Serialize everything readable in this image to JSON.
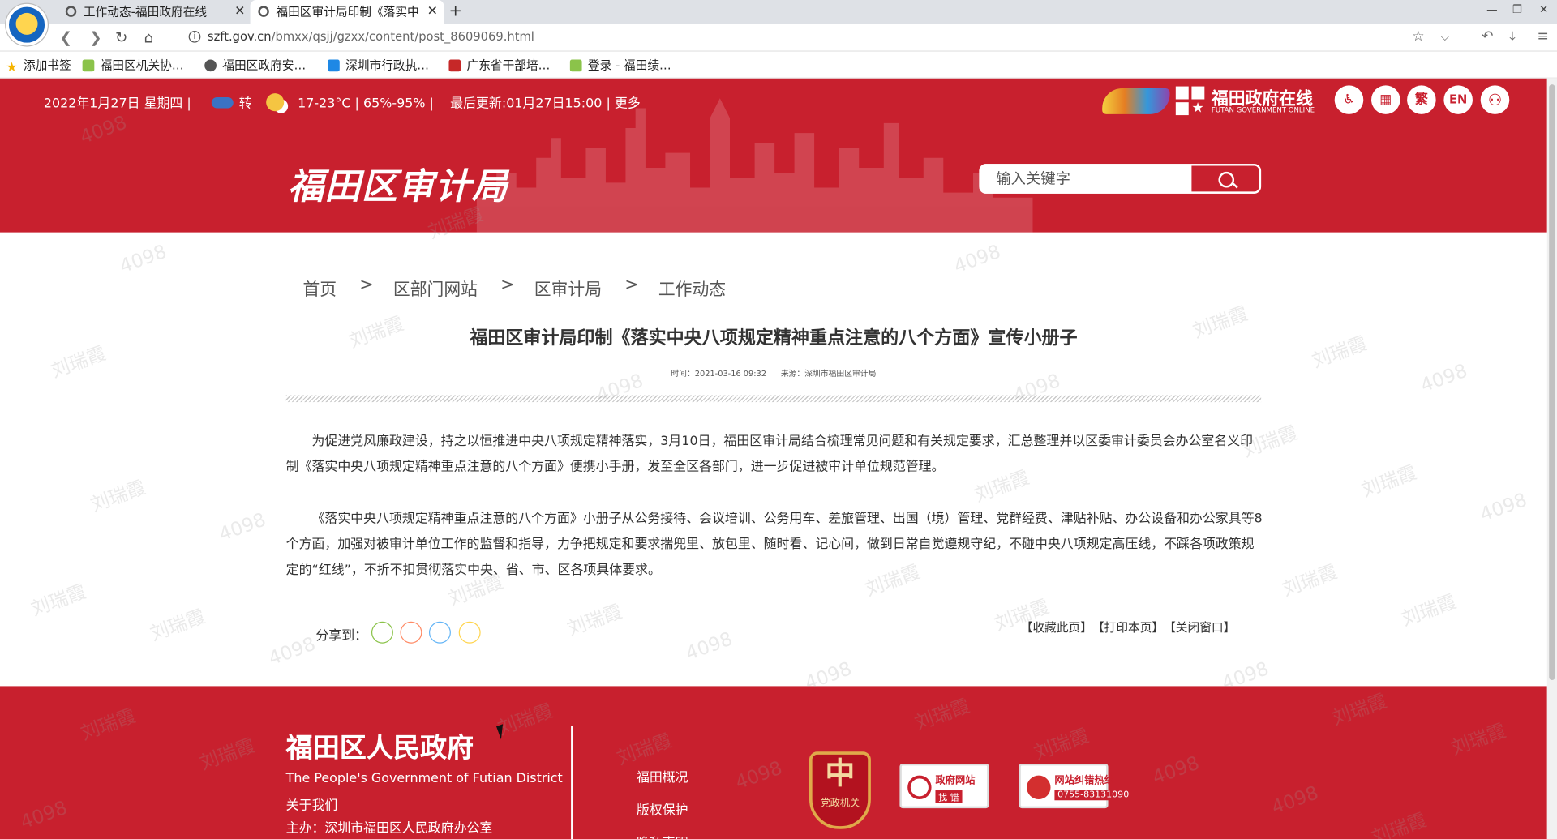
{
  "browser": {
    "tabs": [
      {
        "title": "工作动态-福田政府在线",
        "active": false
      },
      {
        "title": "福田区审计局印制《落实中",
        "active": true
      }
    ],
    "url_host": "szft.gov.cn",
    "url_path": "/bmxx/qsjj/gzxx/content/post_8609069.html",
    "bookmarks": [
      "添加书签",
      "福田区机关协…",
      "福田区政府安…",
      "深圳市行政执…",
      "广东省干部培…",
      "登录 - 福田绩…"
    ]
  },
  "site": {
    "topbar": {
      "date": "2022年1月27日 星期四 |",
      "weather_change": "转",
      "weather": "17-23°C | 65%-95% |",
      "update": "最后更新:01月27日15:00 | 更多"
    },
    "brand_title": "福田政府在线",
    "brand_subtitle": "FUTAN GOVERNMENT ONLINE",
    "header_icons": [
      {
        "name": "accessibility-icon",
        "label": "♿"
      },
      {
        "name": "calendar-icon",
        "label": "▦"
      },
      {
        "name": "traditional-chinese-icon",
        "label": "繁"
      },
      {
        "name": "english-icon",
        "label": "EN"
      },
      {
        "name": "sitemap-icon",
        "label": "⚇"
      }
    ],
    "title": "福田区审计局",
    "search_placeholder": "输入关键字"
  },
  "breadcrumb": [
    "首页",
    "区部门网站",
    "区审计局",
    "工作动态"
  ],
  "breadcrumb_sep": ">",
  "article": {
    "title": "福田区审计局印制《落实中央八项规定精神重点注意的八个方面》宣传小册子",
    "time": "时间：2021-03-16 09:32",
    "source": "来源：深圳市福田区审计局",
    "paragraphs": [
      "为促进党风廉政建设，持之以恒推进中央八项规定精神落实，3月10日，福田区审计局结合梳理常见问题和有关规定要求，汇总整理并以区委审计委员会办公室名义印制《落实中央八项规定精神重点注意的八个方面》便携小手册，发至全区各部门，进一步促进被审计单位规范管理。",
      "《落实中央八项规定精神重点注意的八个方面》小册子从公务接待、会议培训、公务用车、差旅管理、出国（境）管理、党群经费、津贴补贴、办公设备和办公家具等8个方面，加强对被审计单位工作的监督和指导，力争把规定和要求揣兜里、放包里、随时看、记心间，做到日常自觉遵规守纪，不碰中央八项规定高压线，不踩各项政策规定的“红线”，不折不扣贯彻落实中央、省、市、区各项具体要求。"
    ],
    "share_label": "分享到：",
    "tools": [
      "【收藏此页】",
      "【打印本页】",
      "【关闭窗口】"
    ]
  },
  "footer": {
    "title": "福田区人民政府",
    "english": "The People's Government of Futian District",
    "about": "关于我们",
    "host": "主办：深圳市福田区人民政府办公室",
    "links": [
      "福田概况",
      "版权保护",
      "隐私声明"
    ],
    "badge_label": "党政机关",
    "badge_symbol": "中",
    "btn1_line1": "政府网站",
    "btn1_line2": "找 错",
    "btn2_line1": "网站纠错热线",
    "btn2_line2": "0755-83131090"
  },
  "watermark": [
    "4098",
    "刘瑞霞"
  ],
  "colors": {
    "brand_red": "#c8202e",
    "white": "#ffffff"
  }
}
